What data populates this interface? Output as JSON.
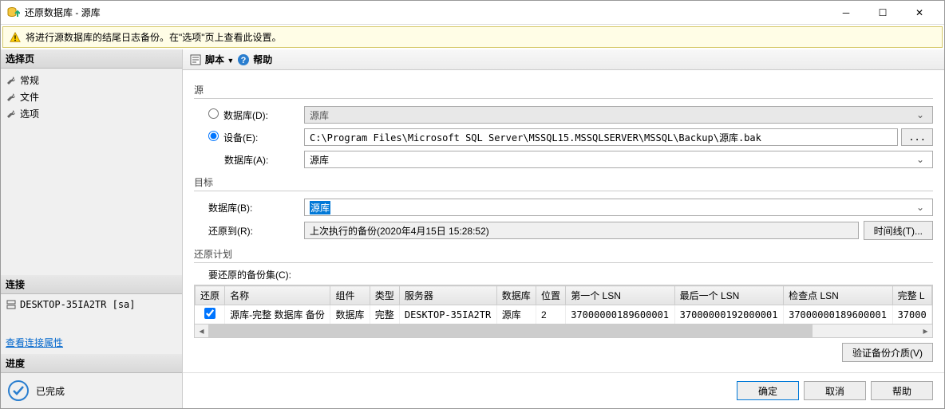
{
  "window": {
    "title": "还原数据库 - 源库"
  },
  "warning": {
    "text": "将进行源数据库的结尾日志备份。在\"选项\"页上查看此设置。"
  },
  "sidebar": {
    "select_page_header": "选择页",
    "pages": [
      {
        "label": "常规"
      },
      {
        "label": "文件"
      },
      {
        "label": "选项"
      }
    ],
    "connection_header": "连接",
    "connection_value": "DESKTOP-35IA2TR [sa]",
    "view_conn_props": "查看连接属性",
    "progress_header": "进度",
    "progress_status": "已完成"
  },
  "toolbar": {
    "script": "脚本",
    "help": "帮助"
  },
  "source": {
    "group": "源",
    "db_radio": "数据库(D):",
    "db_value": "源库",
    "device_radio": "设备(E):",
    "device_path": "C:\\Program Files\\Microsoft SQL Server\\MSSQL15.MSSQLSERVER\\MSSQL\\Backup\\源库.bak",
    "browse": "...",
    "db_a_label": "数据库(A):",
    "db_a_value": "源库"
  },
  "target": {
    "group": "目标",
    "db_label": "数据库(B):",
    "db_value": "源库",
    "restore_to_label": "还原到(R):",
    "restore_to_value": "上次执行的备份(2020年4月15日 15:28:52)",
    "timeline_btn": "时间线(T)..."
  },
  "plan": {
    "group": "还原计划",
    "sets_label": "要还原的备份集(C):",
    "headers": {
      "restore": "还原",
      "name": "名称",
      "component": "组件",
      "type": "类型",
      "server": "服务器",
      "database": "数据库",
      "position": "位置",
      "first_lsn": "第一个 LSN",
      "last_lsn": "最后一个 LSN",
      "checkpoint_lsn": "检查点 LSN",
      "full_lsn": "完整 L"
    },
    "rows": [
      {
        "checked": true,
        "name": "源库-完整 数据库 备份",
        "component": "数据库",
        "type": "完整",
        "server": "DESKTOP-35IA2TR",
        "database": "源库",
        "position": "2",
        "first_lsn": "37000000189600001",
        "last_lsn": "37000000192000001",
        "checkpoint_lsn": "37000000189600001",
        "full_lsn": "37000"
      }
    ],
    "verify_btn": "验证备份介质(V)"
  },
  "footer": {
    "ok": "确定",
    "cancel": "取消",
    "help": "帮助"
  }
}
